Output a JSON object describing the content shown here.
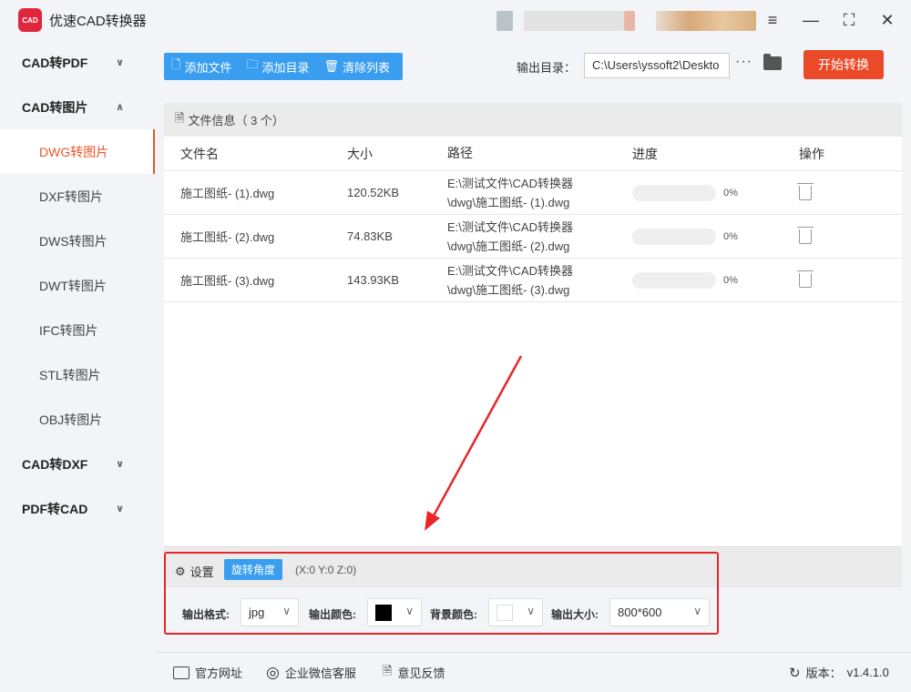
{
  "app": {
    "title": "优速CAD转换器",
    "logo_text": "CAD"
  },
  "window": {
    "menu_icon": "≡",
    "min_icon": "—",
    "max_icon": "⛶",
    "close_icon": "✕"
  },
  "sidebar": {
    "groups": [
      {
        "label": "CAD转PDF",
        "expanded": false
      },
      {
        "label": "CAD转图片",
        "expanded": true,
        "items": [
          "DWG转图片",
          "DXF转图片",
          "DWS转图片",
          "DWT转图片",
          "IFC转图片",
          "STL转图片",
          "OBJ转图片"
        ],
        "active": "DWG转图片"
      },
      {
        "label": "CAD转DXF",
        "expanded": false
      },
      {
        "label": "PDF转CAD",
        "expanded": false
      }
    ]
  },
  "toolbar": {
    "add_file": "添加文件",
    "add_dir": "添加目录",
    "clear_list": "清除列表"
  },
  "output": {
    "label": "输出目录：",
    "path": "C:\\Users\\yssoft2\\Deskto",
    "more": "···"
  },
  "start_button": "开始转换",
  "file_panel": {
    "header": "文件信息（ 3 个）",
    "columns": [
      "文件名",
      "大小",
      "路径",
      "进度",
      "操作"
    ],
    "rows": [
      {
        "name": "施工图纸- (1).dwg",
        "size": "120.52KB",
        "path": "E:\\测试文件\\CAD转换器\\dwg\\施工图纸- (1).dwg",
        "progress": 0,
        "progress_text": "0%"
      },
      {
        "name": "施工图纸- (2).dwg",
        "size": "74.83KB",
        "path": "E:\\测试文件\\CAD转换器\\dwg\\施工图纸- (2).dwg",
        "progress": 0,
        "progress_text": "0%"
      },
      {
        "name": "施工图纸- (3).dwg",
        "size": "143.93KB",
        "path": "E:\\测试文件\\CAD转换器\\dwg\\施工图纸- (3).dwg",
        "progress": 0,
        "progress_text": "0%"
      }
    ]
  },
  "settings": {
    "label": "设置",
    "rotate_button": "旋转角度",
    "coords": "(X:0 Y:0 Z:0)",
    "format_label": "输出格式:",
    "format_value": "jpg",
    "color_label": "输出颜色:",
    "color_value": "#000000",
    "bg_label": "背景颜色:",
    "bg_value": "#ffffff",
    "size_label": "输出大小:",
    "size_value": "800*600"
  },
  "footer": {
    "website": "官方网址",
    "wechat": "企业微信客服",
    "feedback": "意见反馈",
    "version_label": "版本：",
    "version": "v1.4.1.0"
  },
  "colors": {
    "accent": "#3a9ef0",
    "primary": "#ea4a28",
    "highlight": "#e8262a",
    "active_nav": "#e8562a"
  }
}
